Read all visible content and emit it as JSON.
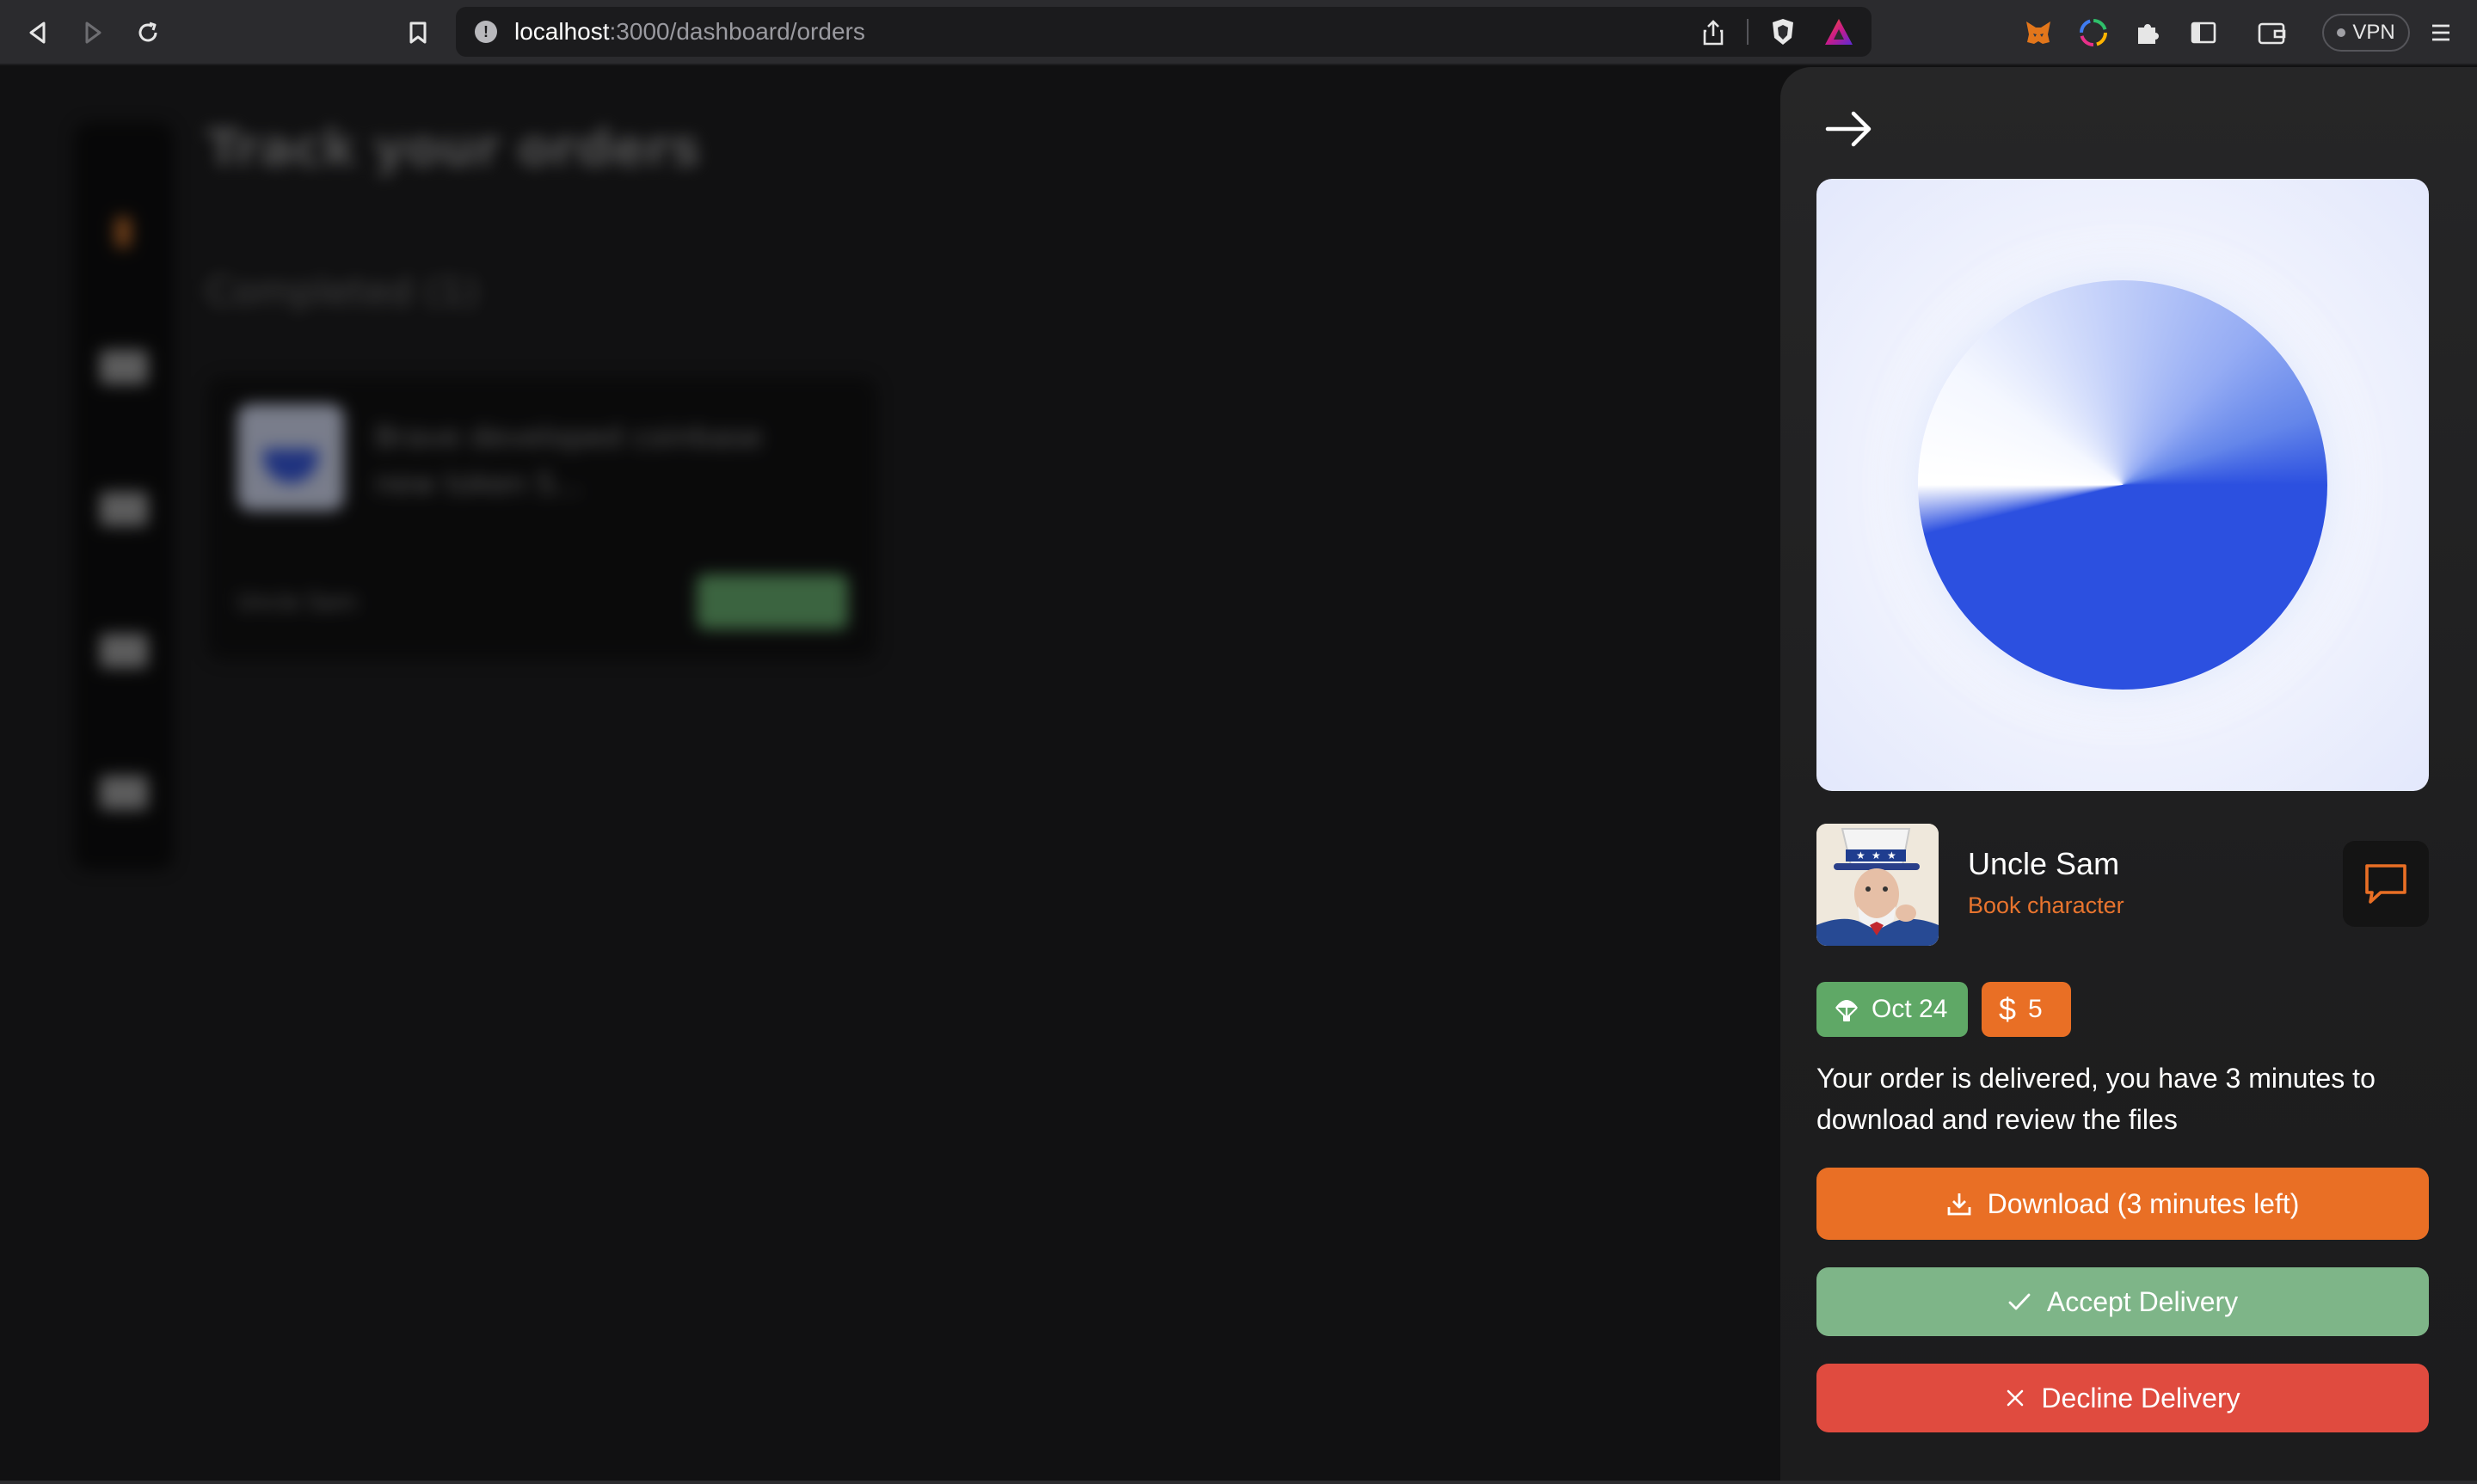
{
  "browser": {
    "url_host": "localhost",
    "url_path": ":3000/dashboard/orders",
    "vpn_label": "VPN"
  },
  "background_page": {
    "title": "Track your orders",
    "section": "Completed (1)",
    "card": {
      "title": "Brave developed coinbase new token S...",
      "user": "Uncle Sam"
    }
  },
  "order": {
    "seller": {
      "name": "Uncle Sam",
      "role": "Book character"
    },
    "date": "Oct 24",
    "price": "5",
    "message": "Your order is delivered, you have 3 minutes to download and review the files",
    "actions": {
      "download": "Download (3 minutes left)",
      "accept": "Accept Delivery",
      "decline": "Decline Delivery"
    }
  },
  "colors": {
    "accent_orange": "#e96f25",
    "success_green": "#7eb588",
    "badge_green": "#5fa866",
    "danger_red": "#e04b3f",
    "pie_blue": "#2c50e0"
  }
}
